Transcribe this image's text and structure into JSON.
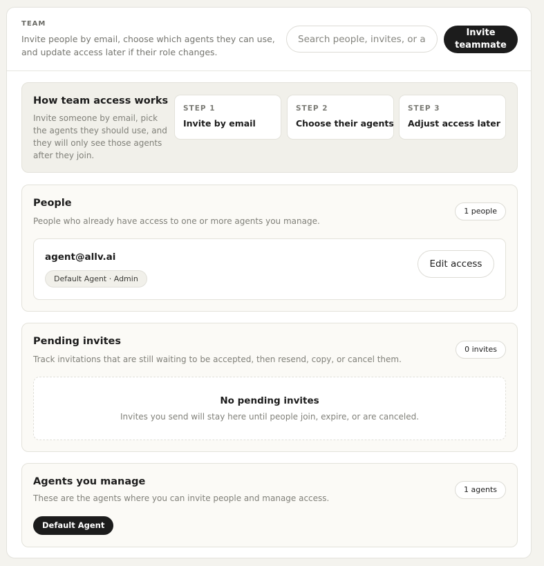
{
  "header": {
    "eyebrow": "TEAM",
    "description": "Invite people by email, choose which agents they can use, and update access later if their role changes.",
    "search_placeholder": "Search people, invites, or agents",
    "invite_label": "Invite teammate"
  },
  "how": {
    "title": "How team access works",
    "description": "Invite someone by email, pick the agents they should use, and they will only see those agents after they join.",
    "steps": [
      {
        "label": "STEP 1",
        "text": "Invite by email"
      },
      {
        "label": "STEP 2",
        "text": "Choose their agents"
      },
      {
        "label": "STEP 3",
        "text": "Adjust access later"
      }
    ]
  },
  "people": {
    "title": "People",
    "description": "People who already have access to one or more agents you manage.",
    "count": "1 people",
    "items": [
      {
        "email": "agent@allv.ai",
        "role": "Default Agent · Admin",
        "action": "Edit access"
      }
    ]
  },
  "invites": {
    "title": "Pending invites",
    "description": "Track invitations that are still waiting to be accepted, then resend, copy, or cancel them.",
    "count": "0 invites",
    "empty_title": "No pending invites",
    "empty_desc": "Invites you send will stay here until people join, expire, or are canceled."
  },
  "agents": {
    "title": "Agents you manage",
    "description": "These are the agents where you can invite people and manage access.",
    "count": "1 agents",
    "items": [
      "Default Agent"
    ]
  },
  "colors": {
    "primary": "#1c1c1c",
    "background": "#f4f3ee",
    "panel": "#fbfaf6"
  }
}
